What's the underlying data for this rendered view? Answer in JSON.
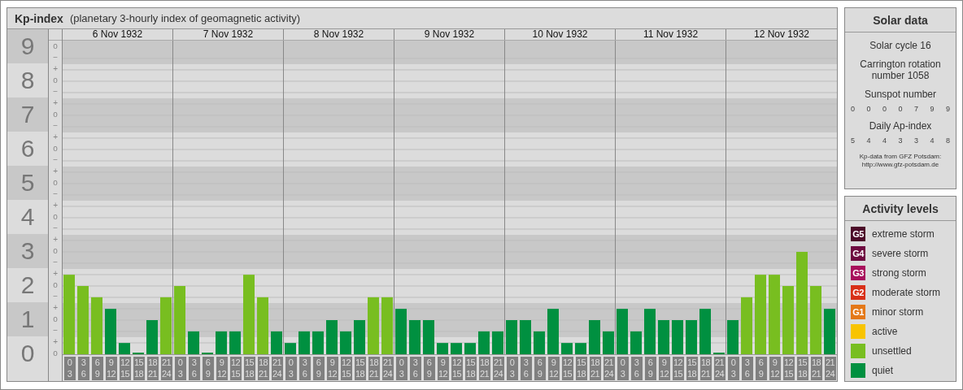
{
  "header": {
    "title": "Kp-index",
    "subtitle": "(planetary 3-hourly index of geomagnetic activity)"
  },
  "kp_chart": {
    "sub_labels": [
      "o",
      "−",
      "+",
      "o",
      "−",
      "+",
      "o",
      "−",
      "+",
      "o",
      "−",
      "+",
      "o",
      "−",
      "+",
      "o",
      "−",
      "+",
      "o",
      "−",
      "+",
      "o",
      "−",
      "+",
      "o",
      "−",
      "+",
      "o"
    ],
    "days": [
      {
        "date": "6 Nov 1932"
      },
      {
        "date": "7 Nov 1932"
      },
      {
        "date": "8 Nov 1932"
      },
      {
        "date": "9 Nov 1932"
      },
      {
        "date": "10 Nov 1932"
      },
      {
        "date": "11 Nov 1932"
      },
      {
        "date": "12 Nov 1932"
      }
    ],
    "chart_data": {
      "type": "bar",
      "grid": true,
      "ylim": [
        0,
        9.19
      ],
      "bands": [
        {
          "axis": "y",
          "from": 0.5,
          "to": 1.5,
          "color": "#c8c8c8"
        },
        {
          "axis": "y",
          "from": 2.5,
          "to": 3.5,
          "color": "#c8c8c8"
        },
        {
          "axis": "y",
          "from": 4.5,
          "to": 5.5,
          "color": "#c8c8c8"
        },
        {
          "axis": "y",
          "from": 6.5,
          "to": 7.5,
          "color": "#c8c8c8"
        },
        {
          "axis": "y",
          "from": 8.5,
          "to": 9.19,
          "color": "#c8c8c8"
        }
      ],
      "yticks": [
        0,
        1,
        2,
        3,
        4,
        5,
        6,
        7,
        8,
        9
      ],
      "categories": [
        "0\n3",
        "3\n6",
        "6\n9",
        "9\n12",
        "12\n15",
        "15\n18",
        "18\n21",
        "21\n24",
        "0\n3",
        "3\n6",
        "6\n9",
        "9\n12",
        "12\n15",
        "15\n18",
        "18\n21",
        "21\n24",
        "0\n3",
        "3\n6",
        "6\n9",
        "9\n12",
        "12\n15",
        "15\n18",
        "18\n21",
        "21\n24",
        "0\n3",
        "3\n6",
        "6\n9",
        "9\n12",
        "12\n15",
        "15\n18",
        "18\n21",
        "21\n24",
        "0\n3",
        "3\n6",
        "6\n9",
        "9\n12",
        "12\n15",
        "15\n18",
        "18\n21",
        "21\n24",
        "0\n3",
        "3\n6",
        "6\n9",
        "9\n12",
        "12\n15",
        "15\n18",
        "18\n21",
        "21\n24",
        "0\n3",
        "3\n6",
        "6\n9",
        "9\n12",
        "12\n15",
        "15\n18",
        "18\n21",
        "21\n24"
      ],
      "series": [
        {
          "color": "#009040",
          "values": [
            null,
            null,
            null,
            1.33,
            0.33,
            0,
            1,
            null,
            null,
            0.67,
            0,
            0.67,
            0.67,
            null,
            null,
            0.67,
            0.33,
            0.67,
            0.67,
            1,
            0.67,
            1,
            null,
            null,
            1.33,
            1,
            1,
            0.33,
            0.33,
            0.33,
            0.67,
            0.67,
            1,
            1,
            0.67,
            1.33,
            0.33,
            0.33,
            1,
            0.67,
            1.33,
            0.67,
            1.33,
            1,
            1,
            1,
            1.33,
            0,
            1,
            null,
            null,
            null,
            null,
            null,
            null,
            1.33
          ]
        },
        {
          "color": "#78be20",
          "values": [
            2.33,
            2,
            1.67,
            null,
            null,
            null,
            null,
            1.67,
            2,
            null,
            null,
            null,
            null,
            2.33,
            1.67,
            null,
            null,
            null,
            null,
            null,
            null,
            null,
            1.67,
            1.67,
            null,
            null,
            null,
            null,
            null,
            null,
            null,
            null,
            null,
            null,
            null,
            null,
            null,
            null,
            null,
            null,
            null,
            null,
            null,
            null,
            null,
            null,
            null,
            null,
            null,
            1.67,
            2.33,
            2.33,
            2,
            3,
            2,
            null
          ]
        }
      ]
    }
  },
  "solar_data": {
    "title": "Solar data",
    "solar_cycle": "Solar cycle 16",
    "carrington": "Carrington rotation number 1058",
    "sunspot_title": "Sunspot number",
    "sunspot_numbers": [
      "0",
      "0",
      "0",
      "0",
      "7",
      "9",
      "9"
    ],
    "ap_title": "Daily Ap-index",
    "ap_values": [
      "5",
      "4",
      "4",
      "3",
      "3",
      "4",
      "8"
    ],
    "source": "Kp-data from GFZ Potsdam:",
    "source_url": "http://www.gfz-potsdam.de"
  },
  "activity_levels": {
    "title": "Activity levels",
    "items": [
      {
        "badge": "G5",
        "label": "extreme storm",
        "color": "#4b0a28"
      },
      {
        "badge": "G4",
        "label": "severe storm",
        "color": "#6e0a40"
      },
      {
        "badge": "G3",
        "label": "strong storm",
        "color": "#a8105c"
      },
      {
        "badge": "G2",
        "label": "moderate storm",
        "color": "#d83018"
      },
      {
        "badge": "G1",
        "label": "minor storm",
        "color": "#e47818"
      },
      {
        "label": "active",
        "color": "#f8c400"
      },
      {
        "label": "unsettled",
        "color": "#78be20"
      },
      {
        "label": "quiet",
        "color": "#009040"
      }
    ]
  }
}
